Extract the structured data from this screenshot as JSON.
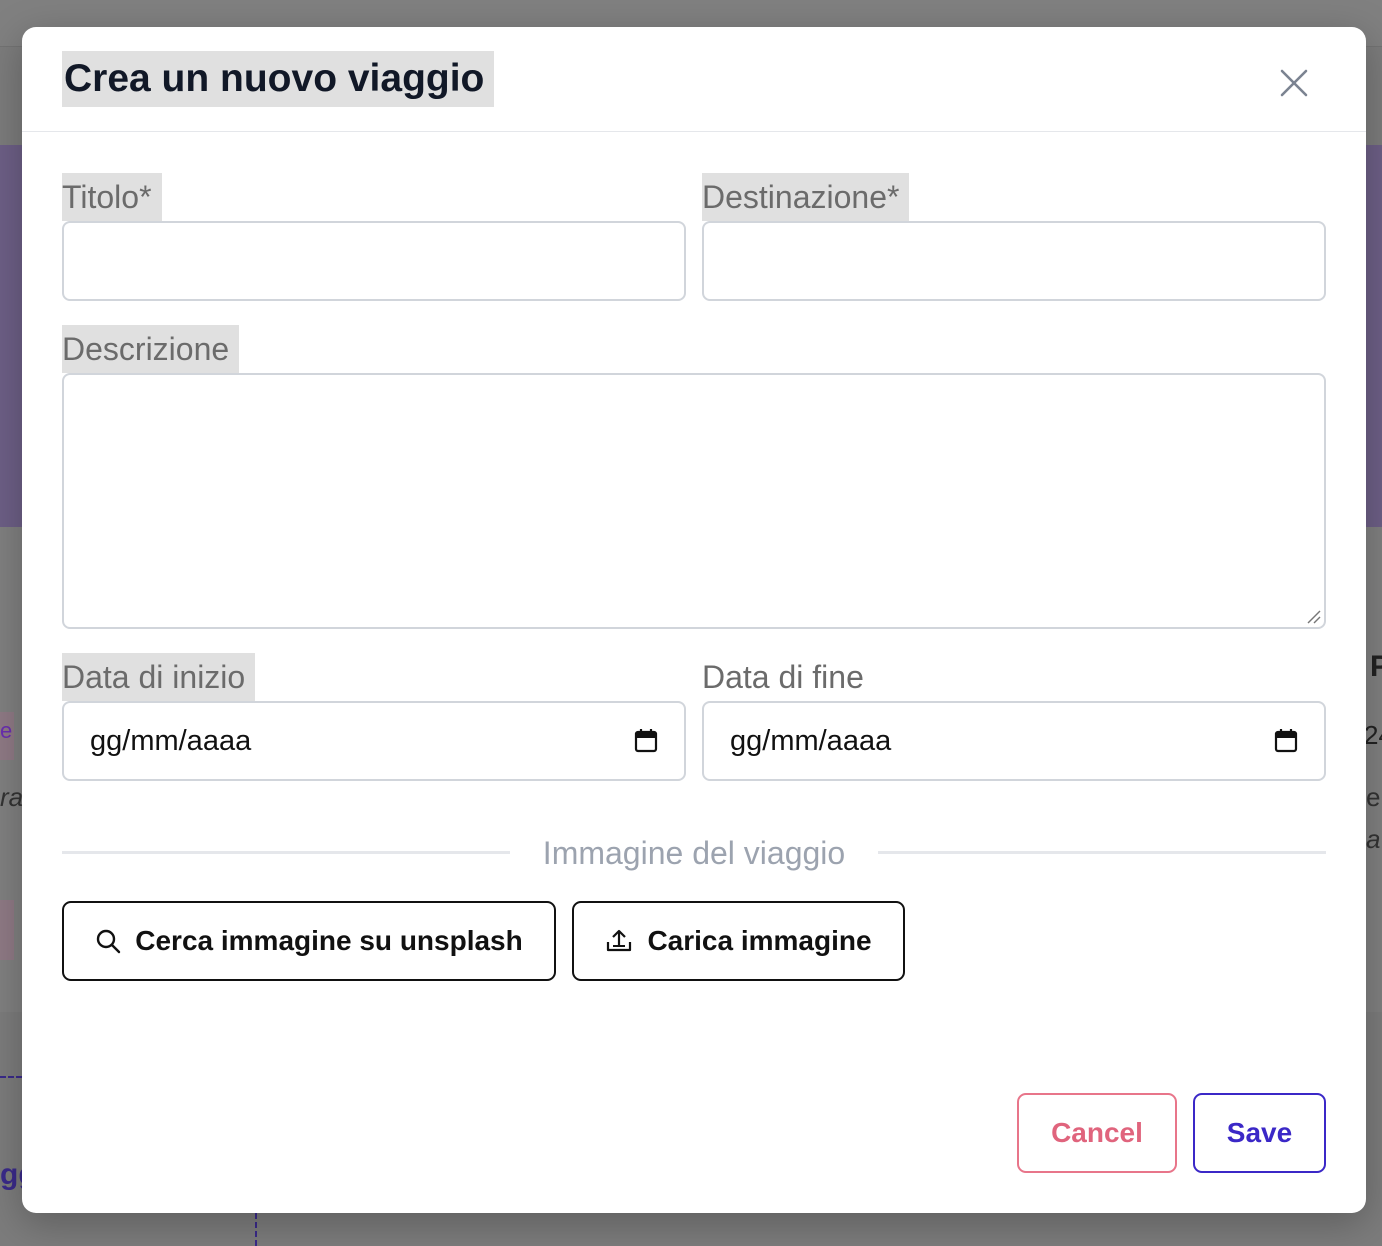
{
  "modal": {
    "title": "Crea un nuovo viaggio"
  },
  "form": {
    "title_label": "Titolo*",
    "title_value": "",
    "destination_label": "Destinazione*",
    "destination_value": "",
    "description_label": "Descrizione",
    "description_value": "",
    "start_date_label": "Data di inizio",
    "start_date_placeholder": "gg/mm/aaaa",
    "end_date_label": "Data di fine",
    "end_date_placeholder": "gg/mm/aaaa"
  },
  "image_section": {
    "label": "Immagine del viaggio",
    "search_unsplash_label": "Cerca immagine su unsplash",
    "upload_label": "Carica immagine"
  },
  "footer": {
    "cancel_label": "Cancel",
    "save_label": "Save"
  },
  "background": {
    "partial_letters": [
      "e",
      "ra",
      "P",
      "24",
      "e",
      "a",
      "gg"
    ]
  },
  "colors": {
    "cancel": "#e0647d",
    "save": "#3b28c7",
    "overlay": "#7c7c7c"
  }
}
